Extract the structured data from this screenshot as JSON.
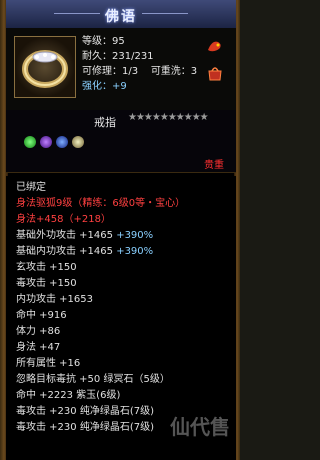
{
  "window": {
    "title": "佛语"
  },
  "item": {
    "level": "等级：95",
    "durability": "耐久：231/231",
    "repairable": "可修理：1/3",
    "rewashable": "可重洗：3",
    "enhance_label": "强化：",
    "enhance_value": "+9"
  },
  "type_label": "戒指",
  "stars": "★★★★★★★★★★",
  "gold_label": "贵重",
  "colors": {
    "blue": "#8ad0ff",
    "red": "#ff4040",
    "title": "#e8eeff"
  },
  "lines": [
    {
      "text": "已绑定",
      "red": false,
      "extra": ""
    },
    {
      "text": "身法驱狐9级（精练：6级0等・宝心）",
      "red": true,
      "extra": ""
    },
    {
      "text": "身法+458（+218）",
      "red": true,
      "extra": ""
    },
    {
      "text": "基础外功攻击 +1465 ",
      "red": false,
      "extra": "+390%"
    },
    {
      "text": "基础内功攻击 +1465 ",
      "red": false,
      "extra": "+390%"
    },
    {
      "text": "玄攻击 +150",
      "red": false,
      "extra": ""
    },
    {
      "text": "毒攻击 +150",
      "red": false,
      "extra": ""
    },
    {
      "text": "内功攻击 +1653",
      "red": false,
      "extra": ""
    },
    {
      "text": "命中 +916",
      "red": false,
      "extra": ""
    },
    {
      "text": "体力 +86",
      "red": false,
      "extra": ""
    },
    {
      "text": "身法 +47",
      "red": false,
      "extra": ""
    },
    {
      "text": "所有属性 +16",
      "red": false,
      "extra": ""
    },
    {
      "text": "忽略目标毒抗 +50 绿冥石（5级）",
      "red": false,
      "extra": ""
    },
    {
      "text": "命中 +2223 紫玉(6级)",
      "red": false,
      "extra": ""
    },
    {
      "text": "毒攻击 +230 纯净绿晶石(7级)",
      "red": false,
      "extra": ""
    },
    {
      "text": "毒攻击 +230 纯净绿晶石(7级)",
      "red": false,
      "extra": ""
    }
  ],
  "watermark": "仙代售"
}
